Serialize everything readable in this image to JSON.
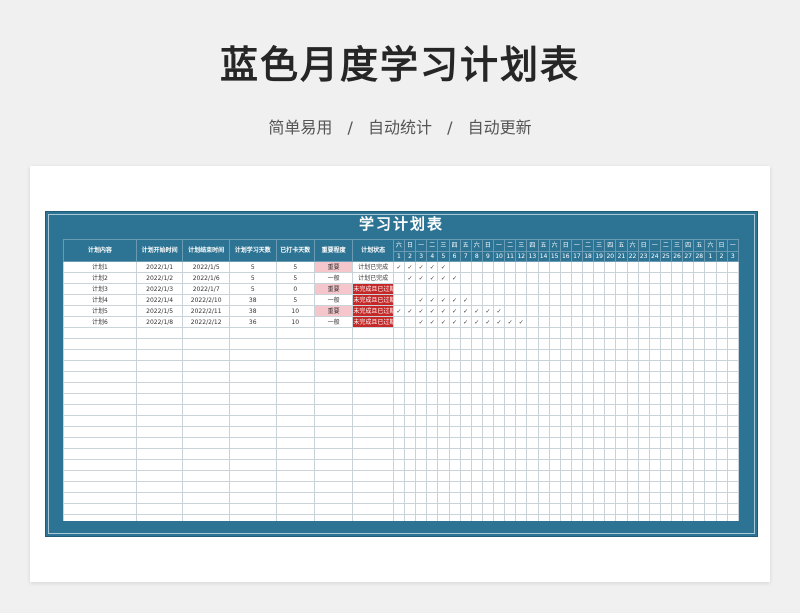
{
  "page": {
    "title": "蓝色月度学习计划表",
    "subtitle": [
      "简单易用",
      "/",
      "自动统计",
      "/",
      "自动更新"
    ]
  },
  "sheet": {
    "title": "学习计划表",
    "headers": [
      "计划内容",
      "计划开始时间",
      "计划结束时间",
      "计划学习天数",
      "已打卡天数",
      "重要程度",
      "计划状态"
    ],
    "weekdays": [
      "六",
      "日",
      "一",
      "二",
      "三",
      "四",
      "五",
      "六",
      "日",
      "一",
      "二",
      "三",
      "四",
      "五",
      "六",
      "日",
      "一",
      "二",
      "三",
      "四",
      "五",
      "六",
      "日",
      "一",
      "二",
      "三",
      "四",
      "五",
      "六",
      "日",
      "一"
    ],
    "days": [
      "1",
      "2",
      "3",
      "4",
      "5",
      "6",
      "7",
      "8",
      "9",
      "10",
      "11",
      "12",
      "13",
      "14",
      "15",
      "16",
      "17",
      "18",
      "19",
      "20",
      "21",
      "22",
      "23",
      "24",
      "25",
      "26",
      "27",
      "28",
      "1",
      "2",
      "3"
    ],
    "rows": [
      {
        "name": "计划1",
        "start": "2022/1/1",
        "end": "2022/1/5",
        "planned": "5",
        "done": "5",
        "importance": "重要",
        "importance_level": "high",
        "status": "计划已完成",
        "status_level": "done",
        "checks": [
          1,
          2,
          3,
          4,
          5
        ]
      },
      {
        "name": "计划2",
        "start": "2022/1/2",
        "end": "2022/1/6",
        "planned": "5",
        "done": "5",
        "importance": "一般",
        "importance_level": "normal",
        "status": "计划已完成",
        "status_level": "done",
        "checks": [
          2,
          3,
          4,
          5,
          6
        ]
      },
      {
        "name": "计划3",
        "start": "2022/1/3",
        "end": "2022/1/7",
        "planned": "5",
        "done": "0",
        "importance": "重要",
        "importance_level": "high",
        "status": "未完成且已过期",
        "status_level": "overdue",
        "checks": []
      },
      {
        "name": "计划4",
        "start": "2022/1/4",
        "end": "2022/2/10",
        "planned": "38",
        "done": "5",
        "importance": "一般",
        "importance_level": "normal",
        "status": "未完成且已过期",
        "status_level": "overdue",
        "checks": [
          3,
          4,
          5,
          6,
          7
        ]
      },
      {
        "name": "计划5",
        "start": "2022/1/5",
        "end": "2022/2/11",
        "planned": "38",
        "done": "10",
        "importance": "重要",
        "importance_level": "high",
        "status": "未完成且已过期",
        "status_level": "overdue",
        "checks": [
          1,
          2,
          3,
          4,
          5,
          6,
          7,
          8,
          9,
          10
        ]
      },
      {
        "name": "计划6",
        "start": "2022/1/8",
        "end": "2022/2/12",
        "planned": "36",
        "done": "10",
        "importance": "一般",
        "importance_level": "normal",
        "status": "未完成且已过期",
        "status_level": "overdue",
        "checks": [
          3,
          4,
          5,
          6,
          7,
          8,
          9,
          10,
          11,
          12
        ]
      }
    ],
    "check_mark": "✓",
    "empty_rows": 19
  },
  "colors": {
    "header_blue": "#2d7393",
    "important_bg": "#f5c6cb",
    "overdue_bg": "#c62828"
  }
}
